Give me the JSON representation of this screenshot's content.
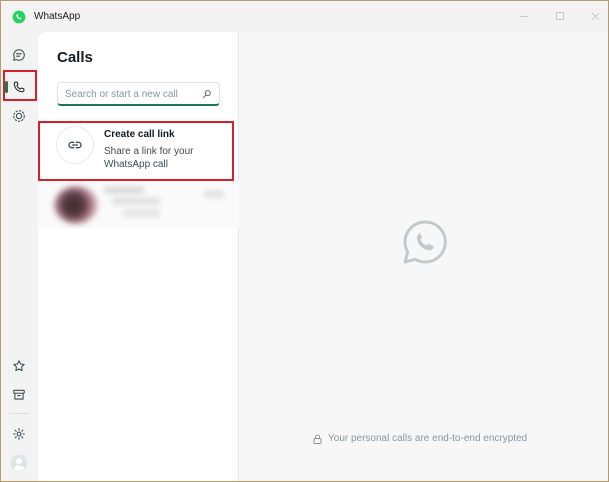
{
  "window": {
    "title": "WhatsApp"
  },
  "rail": {
    "items": [
      {
        "name": "chats",
        "icon": "chat-icon"
      },
      {
        "name": "calls",
        "icon": "phone-icon",
        "active": true
      },
      {
        "name": "status",
        "icon": "status-icon"
      }
    ],
    "bottom_items": [
      {
        "name": "starred",
        "icon": "star-icon"
      },
      {
        "name": "archived",
        "icon": "archive-icon"
      },
      {
        "name": "settings",
        "icon": "gear-icon"
      },
      {
        "name": "profile",
        "icon": "avatar-icon"
      }
    ]
  },
  "calls_panel": {
    "title": "Calls",
    "search": {
      "placeholder": "Search or start a new call",
      "value": ""
    },
    "create_link": {
      "title": "Create call link",
      "subtitle": "Share a link for your WhatsApp call"
    }
  },
  "main": {
    "encryption_note": "Your personal calls are end-to-end encrypted"
  },
  "colors": {
    "accent": "#1b7a4c",
    "highlight": "#d6202b",
    "brand": "#25d366"
  }
}
